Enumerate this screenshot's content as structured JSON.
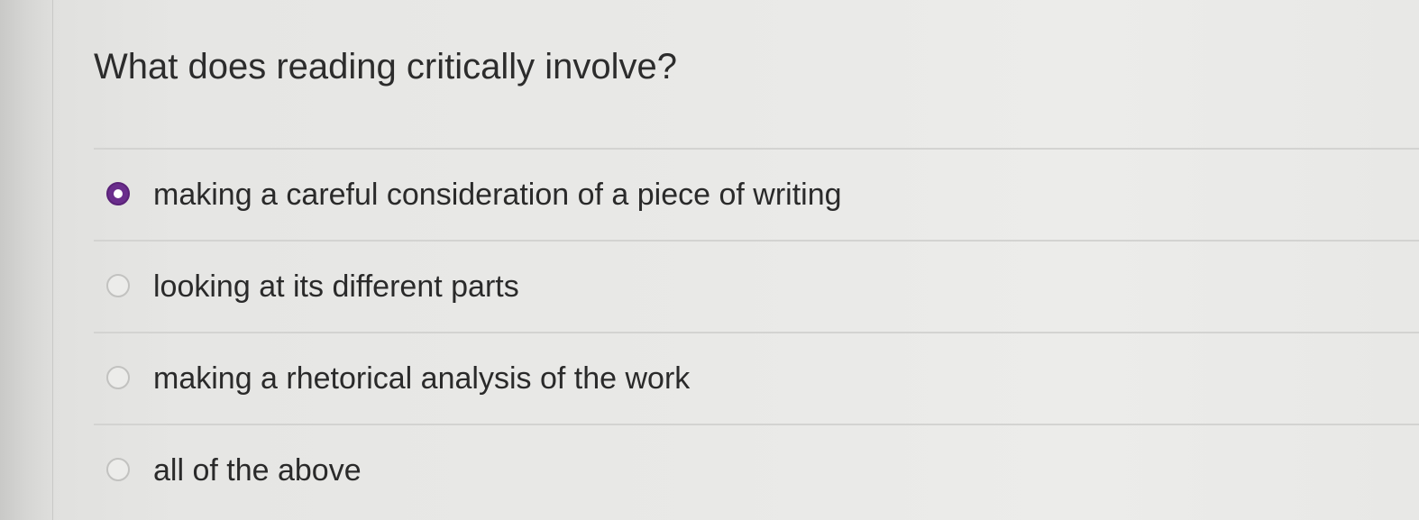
{
  "question": {
    "text": "What does reading critically involve?"
  },
  "options": [
    {
      "label": "making a careful consideration of a piece of writing",
      "selected": true
    },
    {
      "label": "looking at its different parts",
      "selected": false
    },
    {
      "label": "making a rhetorical analysis of the work",
      "selected": false
    },
    {
      "label": "all of the above",
      "selected": false
    }
  ],
  "colors": {
    "selected_radio": "#6a2d8c",
    "background": "#e9e9e7",
    "divider": "#d3d3d1"
  }
}
